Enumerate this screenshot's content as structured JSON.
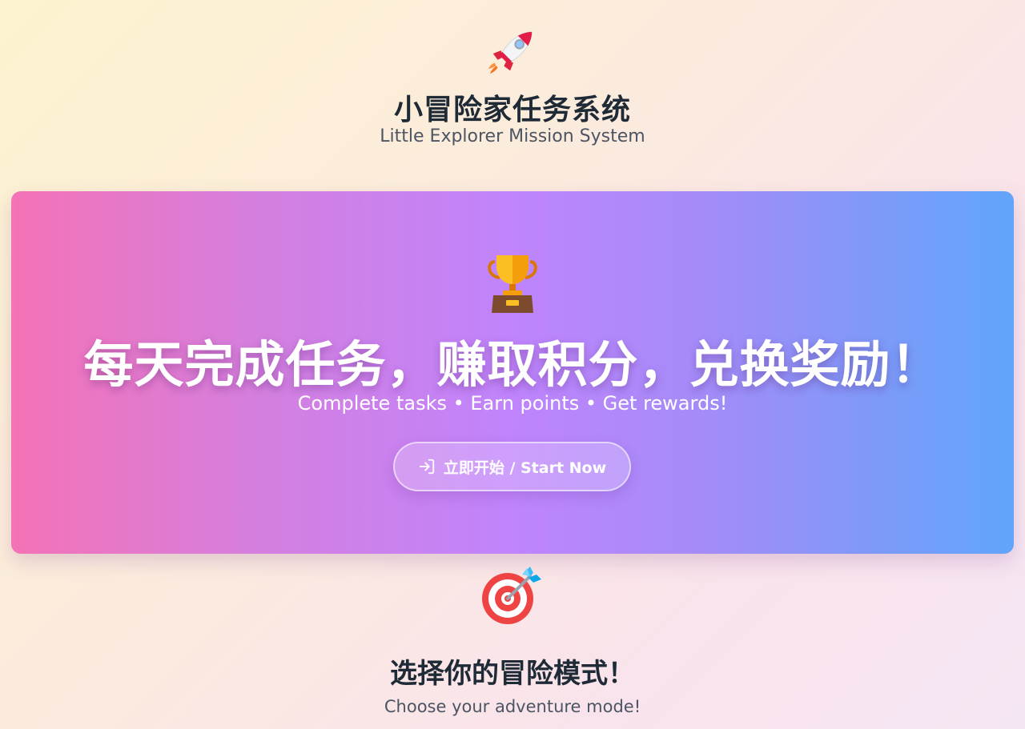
{
  "header": {
    "icon": "rocket-icon",
    "title": "小冒险家任务系统",
    "subtitle": "Little Explorer Mission System"
  },
  "hero": {
    "icon": "trophy-icon",
    "title": "每天完成任务，赚取积分，兑换奖励！",
    "subtitle": "Complete tasks • Earn points • Get rewards!",
    "cta": {
      "icon": "login-icon",
      "label": "立即开始 / Start Now"
    },
    "gradient": [
      "#f472b6",
      "#c084fc",
      "#60a5fa"
    ]
  },
  "mode_section": {
    "icon": "target-dart-icon",
    "title": "选择你的冒险模式！",
    "subtitle": "Choose your adventure mode!"
  }
}
